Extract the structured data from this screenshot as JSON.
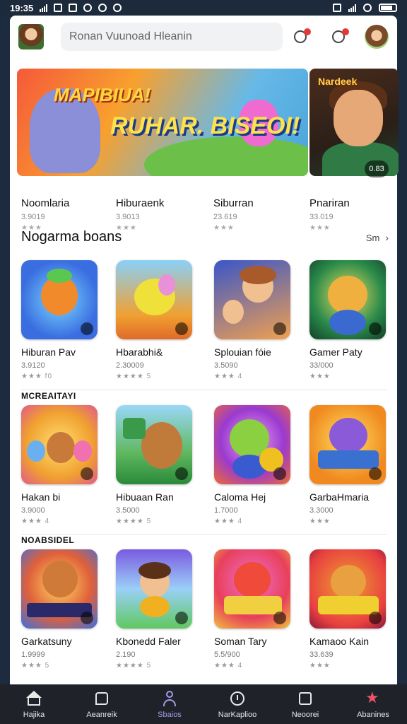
{
  "status_bar": {
    "time": "19:35"
  },
  "header": {
    "search_text": "Ronan Vuunoad Hleanin",
    "icons": [
      "profile-avatar",
      "chat-icon",
      "message-icon",
      "user-avatar"
    ]
  },
  "banners": [
    {
      "title_art_a": "MAPIBIUA!",
      "title_art_b": "RUHAR. BISEOI!",
      "caption": "Noomlaria",
      "sub": "3.9019",
      "stars": "★★★"
    },
    {
      "caption": "Hiburaenk",
      "sub": "3.9013",
      "stars": "★★★"
    },
    {
      "caption": "Siburran",
      "sub": "23.619",
      "stars": "★★★"
    },
    {
      "title_art": "Nardeek",
      "badge": "0.83",
      "caption": "Pnariran",
      "sub": "33.019",
      "stars": "★★★"
    }
  ],
  "section": {
    "title": "Nogarma boans",
    "see_more": "Sm",
    "chevron": "›"
  },
  "groups": [
    {
      "label": "",
      "cards": [
        {
          "title": "Hiburan Pav",
          "sub": "3.9120",
          "stars": "★★★ f0",
          "color_a": "#3a6ee0",
          "color_b": "#55c8f0"
        },
        {
          "title": "Hbarabhi&",
          "sub": "2.30009",
          "stars": "★★★★ 5",
          "color_a": "#f0a030",
          "color_b": "#69c4f0"
        },
        {
          "title": "Splouian fóie",
          "sub": "3.5090",
          "stars": "★★★ 4",
          "color_a": "#3a56c8",
          "color_b": "#f08a3a"
        },
        {
          "title": "Gamer Paty",
          "sub": "33/000",
          "stars": "★★★",
          "color_a": "#1a6e3a",
          "color_b": "#f0d040"
        }
      ]
    },
    {
      "label": "MCREAITAYI",
      "cards": [
        {
          "title": "Hakan bi",
          "sub": "3.9000",
          "stars": "★★★ 4",
          "color_a": "#f0b030",
          "color_b": "#e84a8a"
        },
        {
          "title": "Hibuaan Ran",
          "sub": "3.5000",
          "stars": "★★★★ 5",
          "color_a": "#2aa050",
          "color_b": "#9ad0f0"
        },
        {
          "title": "Caloma Hej",
          "sub": "1.7000",
          "stars": "★★★ 4",
          "color_a": "#9a3ad0",
          "color_b": "#f06a30"
        },
        {
          "title": "GarbaHmaria",
          "sub": "3.3000",
          "stars": "★★★",
          "color_a": "#f08a20",
          "color_b": "#8a4ad8"
        }
      ]
    },
    {
      "label": "NOABSIDEL",
      "cards": [
        {
          "title": "Garkatsuny",
          "sub": "1.9999",
          "stars": "★★★ 5",
          "color_a": "#3a70e0",
          "color_b": "#f0603a"
        },
        {
          "title": "Kbonedd Faler",
          "sub": "2.190",
          "stars": "★★★★ 5",
          "color_a": "#7a5ae0",
          "color_b": "#60c860"
        },
        {
          "title": "Soman Tary",
          "sub": "5.5/900",
          "stars": "★★★ 4",
          "color_a": "#e8405a",
          "color_b": "#f0c040"
        },
        {
          "title": "Kamaoo Kain",
          "sub": "33.639",
          "stars": "★★★",
          "color_a": "#e84040",
          "color_b": "#f0a030"
        }
      ]
    }
  ],
  "bottom_nav": [
    {
      "label": "Hajika",
      "icon": "home-icon",
      "active": false
    },
    {
      "label": "Aeanreik",
      "icon": "chat-icon",
      "active": false
    },
    {
      "label": "Sbaios",
      "icon": "user-icon",
      "active": true
    },
    {
      "label": "NarKaplioo",
      "icon": "clock-icon",
      "active": false
    },
    {
      "label": "Neoorei",
      "icon": "square-icon",
      "active": false
    },
    {
      "label": "Abanines",
      "icon": "star-icon",
      "active": false
    }
  ],
  "colors": {
    "accent": "#a79ae8",
    "badge_red": "#e23a3a",
    "nav_bg": "#1f2229"
  }
}
